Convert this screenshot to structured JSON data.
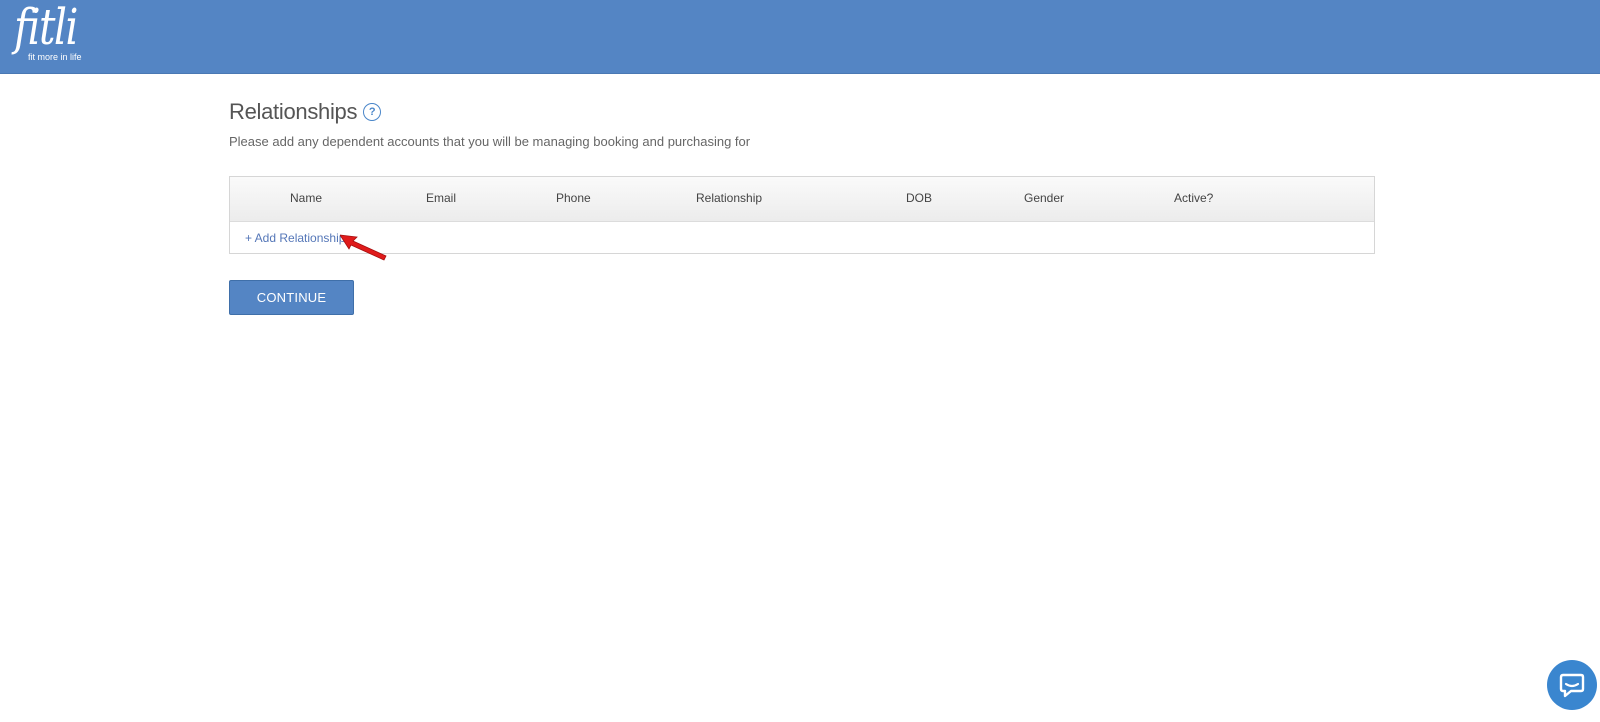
{
  "header": {
    "logo_text": "fitli",
    "logo_tagline": "fit more in life",
    "background_color": "#5485c4"
  },
  "main": {
    "title": "Relationships",
    "help_icon": "question-circle-icon",
    "help_glyph": "?",
    "subtitle": "Please add any dependent accounts that you will be managing booking and purchasing for",
    "table": {
      "columns": [
        "Name",
        "Email",
        "Phone",
        "Relationship",
        "DOB",
        "Gender",
        "Active?"
      ],
      "rows": [],
      "add_link_label": "+ Add Relationship"
    },
    "annotation_arrow": {
      "icon": "red-arrow-icon",
      "color": "#e01b1b"
    },
    "continue_label": "CONTINUE"
  },
  "chat_widget": {
    "icon": "chat-bubble-icon",
    "color": "#3a86cf"
  }
}
